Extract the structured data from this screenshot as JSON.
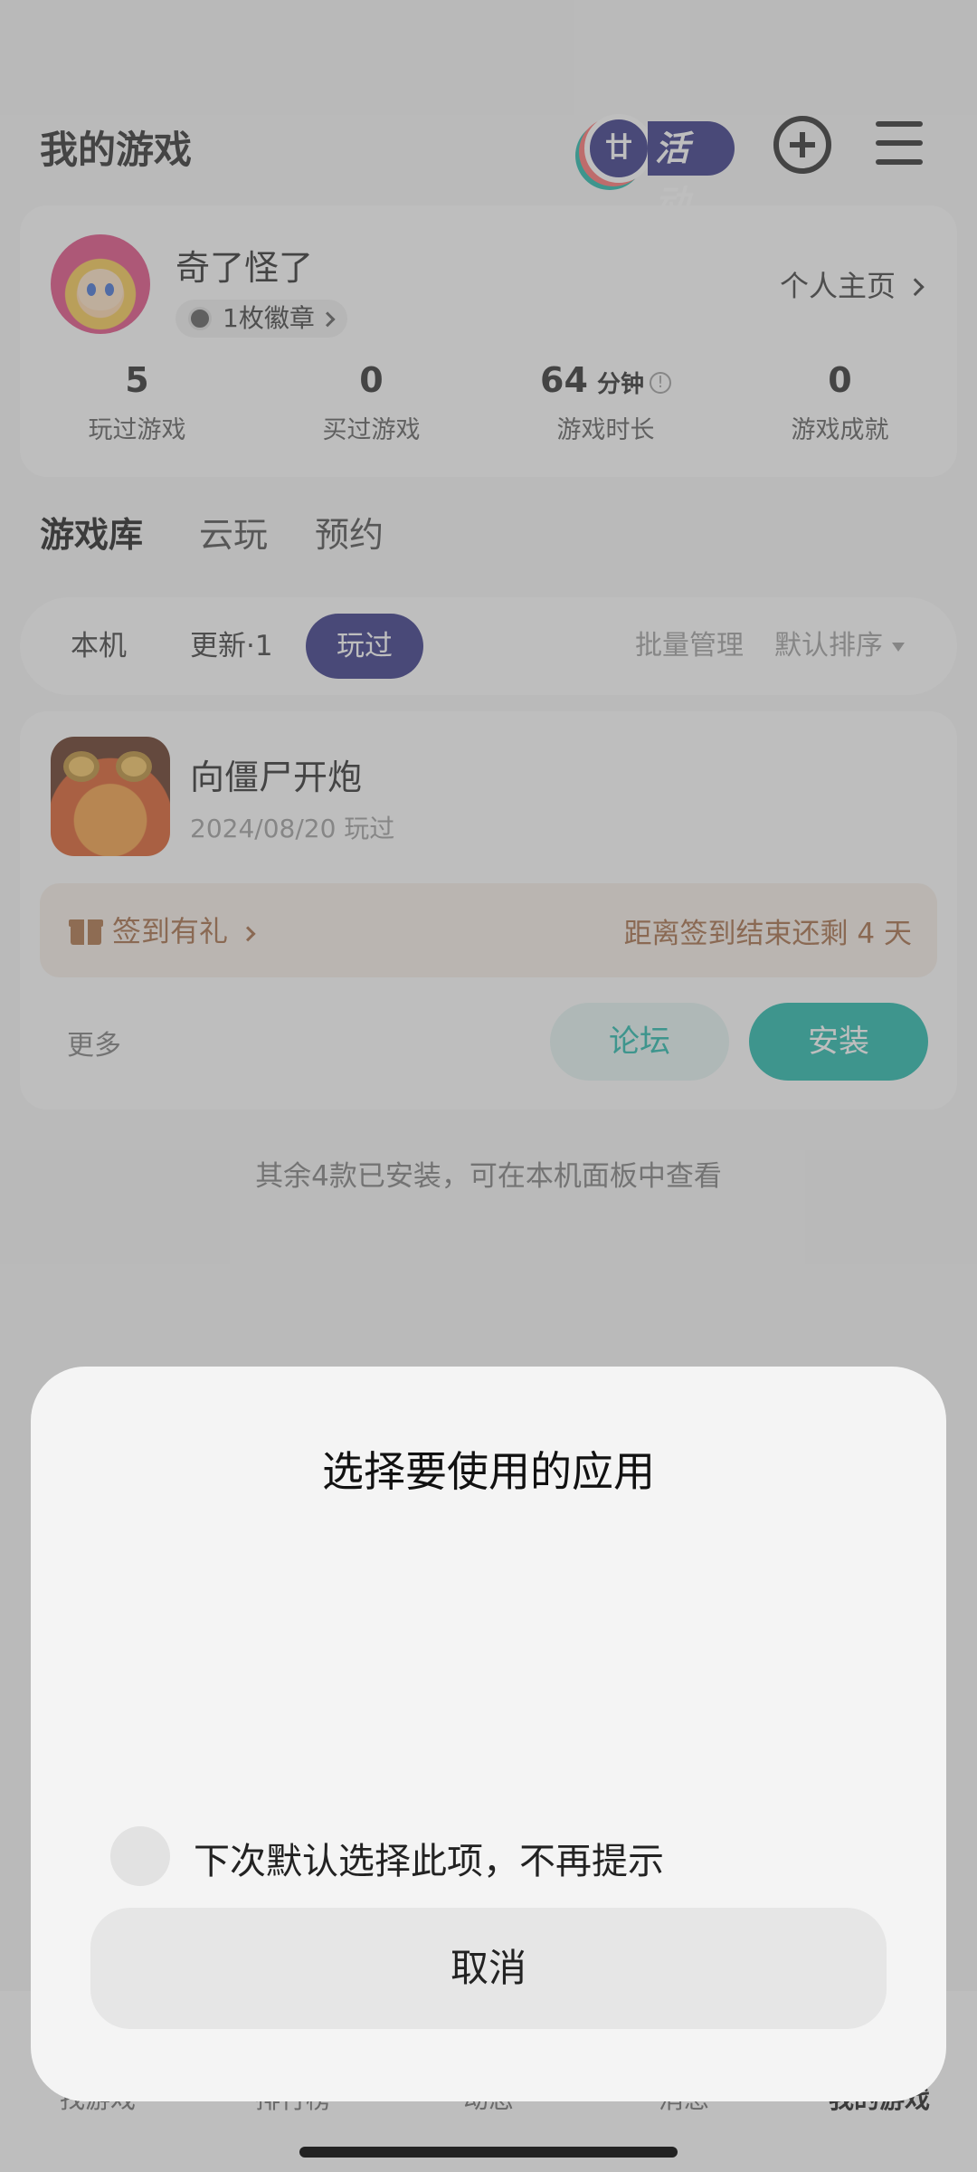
{
  "header": {
    "title": "我的游戏",
    "activity_label": "活动",
    "activity_glyph": "廿"
  },
  "profile": {
    "username": "奇了怪了",
    "badge_text": "1枚徽章",
    "homepage_link": "个人主页",
    "stats": [
      {
        "value": "5",
        "unit": "",
        "label": "玩过游戏"
      },
      {
        "value": "0",
        "unit": "",
        "label": "买过游戏"
      },
      {
        "value": "64",
        "unit": "分钟",
        "label": "游戏时长"
      },
      {
        "value": "0",
        "unit": "",
        "label": "游戏成就"
      }
    ]
  },
  "tabs": [
    {
      "label": "游戏库",
      "active": true
    },
    {
      "label": "云玩",
      "active": false
    },
    {
      "label": "预约",
      "active": false
    }
  ],
  "filters": {
    "items": [
      {
        "label": "本机",
        "active": false
      },
      {
        "label": "更新·1",
        "active": false
      },
      {
        "label": "玩过",
        "active": true
      }
    ],
    "batch_manage": "批量管理",
    "sort_label": "默认排序"
  },
  "game": {
    "title": "向僵尸开炮",
    "played_date": "2024/08/20 玩过",
    "checkin_left": "签到有礼",
    "checkin_right": "距离签到结束还剩 4 天",
    "more_label": "更多",
    "forum_label": "论坛",
    "install_label": "安装"
  },
  "installed_note": "其余4款已安装，可在本机面板中查看",
  "bottom_nav": [
    {
      "label": "找游戏",
      "active": false
    },
    {
      "label": "排行榜",
      "active": false
    },
    {
      "label": "动态",
      "active": false
    },
    {
      "label": "消息",
      "active": false
    },
    {
      "label": "我的游戏",
      "active": true
    }
  ],
  "dialog": {
    "title": "选择要使用的应用",
    "remember_label": "下次默认选择此项，不再提示",
    "cancel_label": "取消"
  },
  "colors": {
    "accent_teal": "#17b5a6",
    "accent_navy": "#2b2b80",
    "checkin_brown": "#a0643c"
  }
}
